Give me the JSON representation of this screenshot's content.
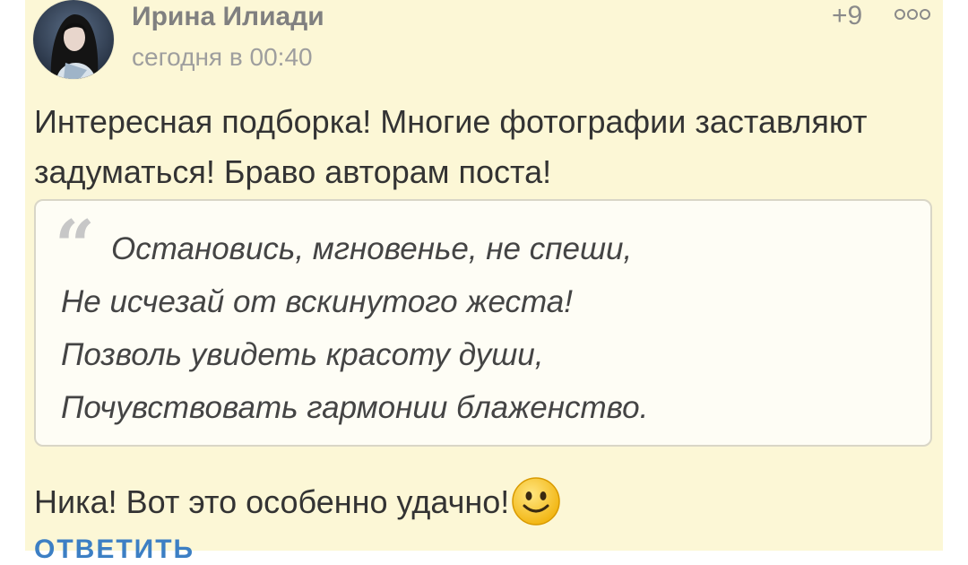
{
  "comment": {
    "author": "Ирина Илиади",
    "time": "сегодня в 00:40",
    "rating": "+9",
    "paragraph1": "Интересная подборка! Многие фотографии заставляют задуматься! Браво авторам поста!",
    "quote": {
      "mark": "“",
      "lines": [
        "Остановись, мгновенье, не спеши,",
        "Не исчезай от вскинутого жеста!",
        "Позволь увидеть красоту души,",
        "Почувствовать гармонии блаженство."
      ]
    },
    "paragraph2": "Ника! Вот это особенно удачно!",
    "reply_label": "ОТВЕТИТЬ"
  },
  "icons": {
    "avatar": "user-avatar-photo",
    "more": "more-options-icon",
    "emoji": "smiley-emoji-icon"
  },
  "colors": {
    "card_background": "#fcf7d6",
    "reply_link": "#3c7fc4",
    "author": "#808080"
  }
}
